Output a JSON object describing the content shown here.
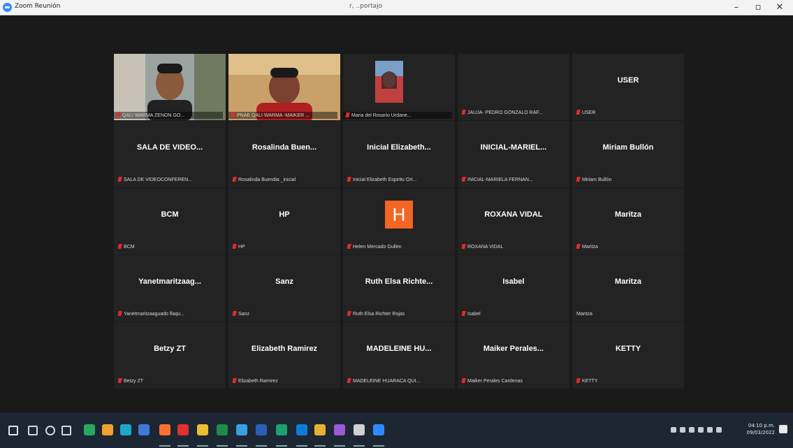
{
  "window": {
    "app_title": "Zoom Reunión",
    "center_title": "r, ..portajo",
    "minimize": "–",
    "restore": "▫",
    "close": "✕"
  },
  "colors": {
    "accent_active": "#b6d43a",
    "mic_muted": "#e02b2b",
    "avatar_orange": "#f26522",
    "tile_bg": "#232323"
  },
  "participants": [
    {
      "display": "",
      "name": "QALI WARMA ZENON GO...",
      "video": "man-photo"
    },
    {
      "display": "",
      "name": "PNAE QALI WARMA -MAIKER ...",
      "video": "man-photo-red",
      "active": true
    },
    {
      "display": "",
      "name": "Maria del Rosario Urdane...",
      "video": "woman-photo"
    },
    {
      "display": "",
      "name": "JAUJA- PEDRO GONZALO RAF...",
      "video": ""
    },
    {
      "display": "USER",
      "name": "USER"
    },
    {
      "display": "SALA DE VIDEO...",
      "name": "SALA DE VIDEOCONFEREN..."
    },
    {
      "display": "Rosalinda Buen...",
      "name": "Rosalinda Buendia _inicial"
    },
    {
      "display": "Inicial Elizabeth...",
      "name": "Inicial Elizabeth Espiritu Ort..."
    },
    {
      "display": "INICIAL-MARIEL...",
      "name": "INICIAL-MARIELA FERNAN..."
    },
    {
      "display": "Miriam Bullón",
      "name": "Miriam Bullón"
    },
    {
      "display": "BCM",
      "name": "BCM"
    },
    {
      "display": "HP",
      "name": "HP"
    },
    {
      "display": "H",
      "name": "Helen Mercado Gullen",
      "avatar_letter": true
    },
    {
      "display": "ROXANA VIDAL",
      "name": "ROXANA VIDAL"
    },
    {
      "display": "Maritza",
      "name": "Maritza"
    },
    {
      "display": "Yanetmaritzaag...",
      "name": "Yanetmaritzaaguado flaqu..."
    },
    {
      "display": "Sanz",
      "name": "Sanz"
    },
    {
      "display": "Ruth Elsa Richte...",
      "name": "Ruth Elsa Richter Rojas"
    },
    {
      "display": "Isabel",
      "name": "Isabel"
    },
    {
      "display": "Maritza",
      "name": "Maritza",
      "no_mic": true
    },
    {
      "display": "Betzy ZT",
      "name": "Betzy ZT"
    },
    {
      "display": "Elizabeth Ramirez",
      "name": "Elizabeth Ramirez"
    },
    {
      "display": "MADELEINE HU...",
      "name": "MADELEINE HUARACA QUI..."
    },
    {
      "display": "Maiker Perales...",
      "name": "Maiker Perales Cardenas"
    },
    {
      "display": "KETTY",
      "name": "KETTY"
    }
  ],
  "taskbar": {
    "icons": [
      "start-icon",
      "search-icon",
      "cortana-icon",
      "task-view-icon",
      "app-green-icon",
      "app-colorful-icon",
      "app-teal-icon",
      "app-blue-icon",
      "firefox-icon",
      "app-red-icon",
      "app-yellow-icon",
      "excel-icon",
      "app-star-icon",
      "word-icon",
      "app-green2-icon",
      "edge-icon",
      "chrome-icon",
      "app-purple-icon",
      "app-pen-icon",
      "zoom-icon"
    ],
    "time": "04:10 p.m.",
    "date": "09/03/2022"
  }
}
